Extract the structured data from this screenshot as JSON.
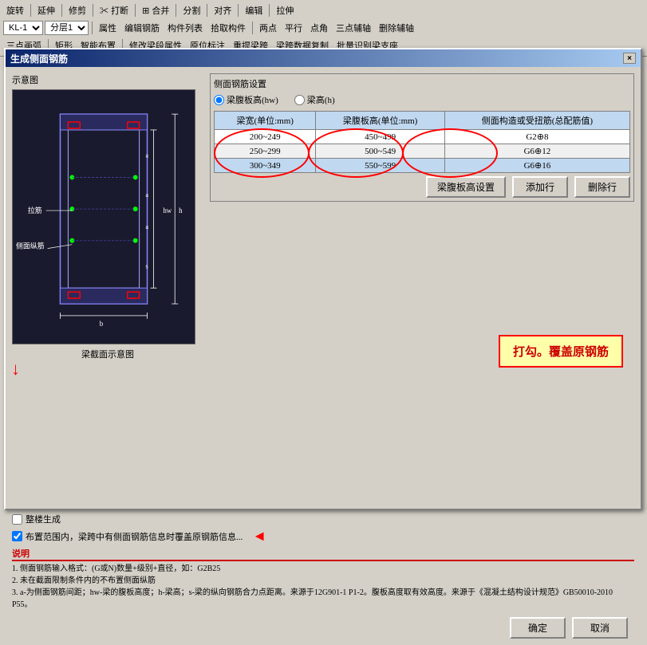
{
  "toolbar": {
    "row1": {
      "items": [
        "旋转",
        "延伸",
        "修剪",
        "打断",
        "合并",
        "分割",
        "对齐",
        "编辑",
        "拉伸"
      ]
    },
    "row2": {
      "layer_select": "KL-1",
      "layer_label": "分层1",
      "items": [
        "属性",
        "编辑钢筋",
        "构件列表",
        "拾取构件",
        "两点",
        "平行",
        "点角",
        "三点辅轴",
        "删除辅轴"
      ]
    },
    "row3": {
      "items": [
        "三点画弧",
        "矩形",
        "智能布置",
        "修改梁段属性",
        "原位标注",
        "重提梁跨",
        "梁跨数据复制",
        "批量识别梁支座"
      ]
    }
  },
  "dialog": {
    "title": "生成侧面钢筋",
    "close_btn": "×",
    "sections": {
      "diagram_label": "示意图",
      "diagram_caption": "梁截面示意图",
      "settings_label": "侧面钢筋设置"
    },
    "radio_options": [
      {
        "label": "梁腹板高(hw)",
        "checked": true
      },
      {
        "label": "梁高(h)",
        "checked": false
      }
    ],
    "table": {
      "headers": [
        "梁宽(单位:mm)",
        "梁腹板高(单位:mm)",
        "侧面构造或受扭筋(总配筋值)"
      ],
      "rows": [
        [
          "200~249",
          "450~499",
          "G2⊕8"
        ],
        [
          "250~299",
          "500~549",
          "G6⊕12"
        ],
        [
          "300~349",
          "550~599",
          "G6⊕16"
        ]
      ]
    },
    "buttons": {
      "add": "添加行",
      "delete": "删除行",
      "beam_height_settings": "梁腹板高设置"
    },
    "checkboxes": [
      {
        "label": "整楼生成",
        "checked": false
      },
      {
        "label": "布置范围内，梁跨中有侧面钢筋信息时覆盖原钢筋信息...",
        "checked": true
      }
    ],
    "notes": {
      "title": "说明",
      "items": [
        "1. 侧面钢筋输入格式：(G或N)数量+级别+直径，如：G2B25",
        "2. 未在截面限制条件内的不布置侧面纵筋",
        "3. a-为侧面钢筋间距；hw-梁的腹板高度；h-梁高；s-梁的纵向钢筋合力点距离。来源于12G901-1 P1-2。腹板高度取有效高度。来源于《混凝土结构设计规范》GB50010-2010 P55。"
      ]
    },
    "bottom_buttons": {
      "confirm": "确定",
      "cancel": "取消"
    }
  },
  "annotation": {
    "text": "打勾。覆盖原钢筋"
  },
  "diagram": {
    "labels": {
      "la_jin": "拉筋",
      "ce_mian_zong_jin": "侧面纵筋",
      "hw_label": "hw",
      "h_label": "h",
      "a_labels": [
        "a",
        "a",
        "a"
      ],
      "s_label": "s",
      "b_label": "b"
    }
  }
}
